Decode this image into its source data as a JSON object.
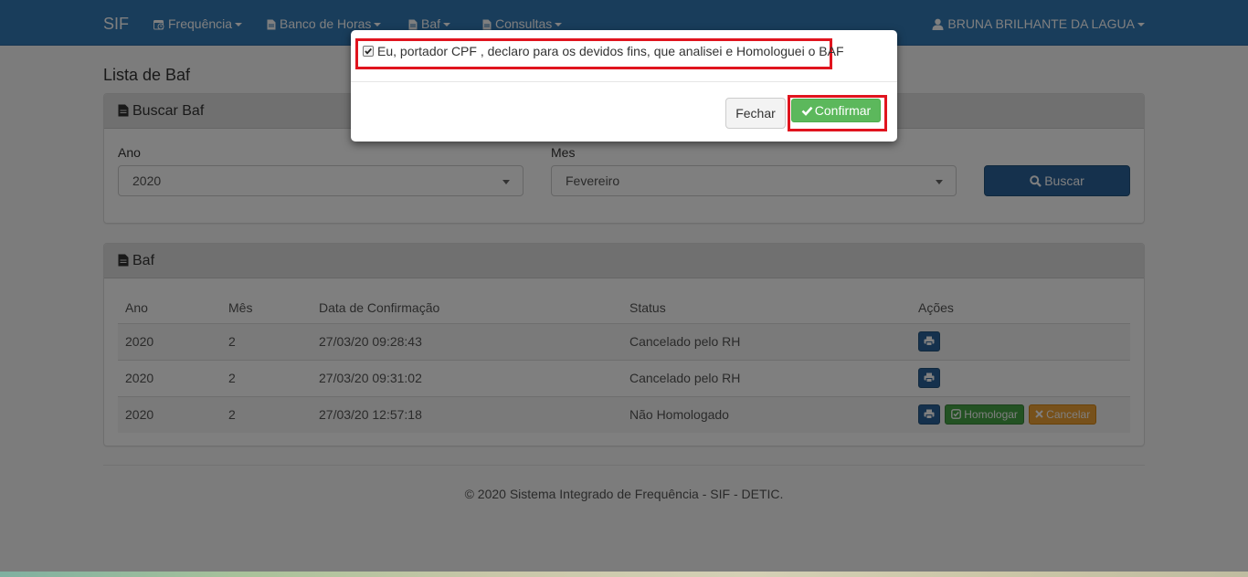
{
  "navbar": {
    "brand": "SIF",
    "items": [
      {
        "label": "Frequência"
      },
      {
        "label": "Banco de Horas"
      },
      {
        "label": "Baf"
      },
      {
        "label": "Consultas"
      }
    ],
    "user": "BRUNA BRILHANTE DA LAGUA"
  },
  "page": {
    "title": "Lista de Baf"
  },
  "search_panel": {
    "heading": "Buscar Baf",
    "year_label": "Ano",
    "year_value": "2020",
    "month_label": "Mes",
    "month_value": "Fevereiro",
    "search_button": "Buscar"
  },
  "table_panel": {
    "heading": "Baf",
    "columns": [
      "Ano",
      "Mês",
      "Data de Confirmação",
      "Status",
      "Ações"
    ],
    "rows": [
      {
        "ano": "2020",
        "mes": "2",
        "data": "27/03/20 09:28:43",
        "status": "Cancelado pelo RH"
      },
      {
        "ano": "2020",
        "mes": "2",
        "data": "27/03/20 09:31:02",
        "status": "Cancelado pelo RH"
      },
      {
        "ano": "2020",
        "mes": "2",
        "data": "27/03/20 12:57:18",
        "status": "Não Homologado",
        "homologar": "Homologar",
        "cancelar": "Cancelar"
      }
    ]
  },
  "footer": {
    "text": "© 2020 Sistema Integrado de Frequência - SIF - DETIC."
  },
  "modal": {
    "declaration": "Eu, portador CPF , declaro para os devidos fins, que analisei e Homologuei o BAF",
    "checked": true,
    "close_button": "Fechar",
    "confirm_button": "Confirmar"
  },
  "colors": {
    "navbar": "#337ab7",
    "primary": "#2a629a",
    "success": "#5cb85c",
    "warning": "#eea236",
    "highlight": "#e0141e"
  }
}
